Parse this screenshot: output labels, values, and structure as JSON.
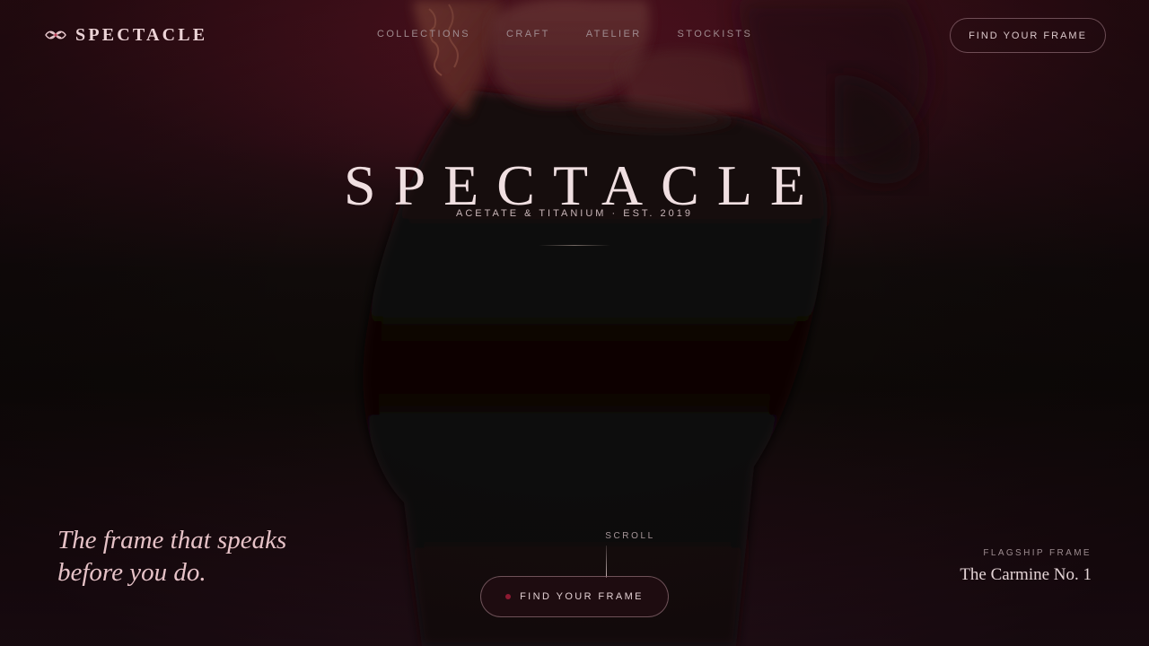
{
  "brand": {
    "name": "SPECTACLE",
    "logo_icon": "spectacles-icon"
  },
  "nav": {
    "items": [
      {
        "label": "COLLECTIONS"
      },
      {
        "label": "CRAFT"
      },
      {
        "label": "ATELIER"
      },
      {
        "label": "STOCKISTS"
      }
    ]
  },
  "header": {
    "cta_label": "FIND YOUR FRAME"
  },
  "hero": {
    "title": "SPECTACLE",
    "subtitle": "ACETATE & TITANIUM · EST. 2019"
  },
  "tagline": {
    "line1": "The frame that speaks",
    "line2": "before you do."
  },
  "scroll": {
    "label": "SCROLL"
  },
  "cta": {
    "label": "FIND YOUR FRAME",
    "dot_color": "#8e1a32"
  },
  "flagship": {
    "label": "FLAGSHIP FRAME",
    "name": "The Carmine No. 1"
  },
  "colors": {
    "accent": "#8e1a32",
    "background": "#140a0d",
    "text": "#e9d5d8"
  }
}
